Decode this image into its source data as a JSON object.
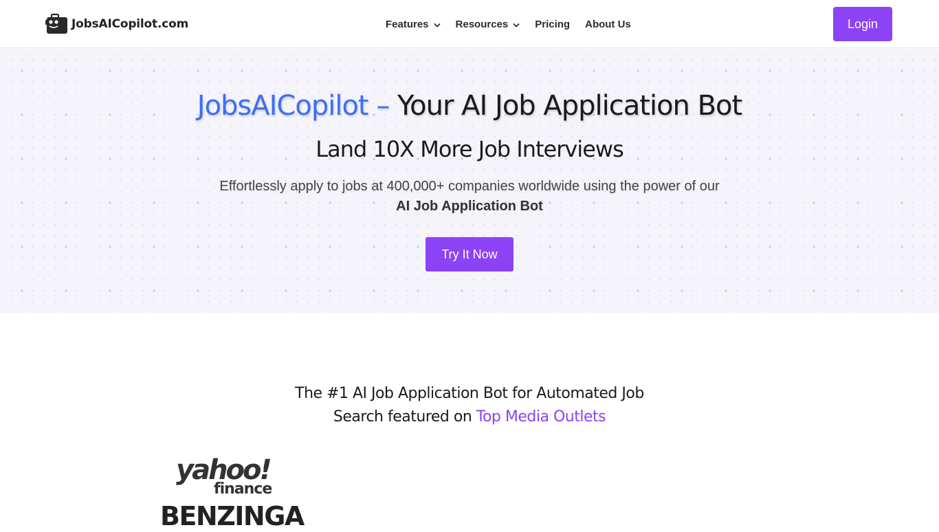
{
  "header": {
    "logo_text": "JobsAICopilot.com",
    "nav": [
      {
        "label": "Features",
        "has_dropdown": true
      },
      {
        "label": "Resources",
        "has_dropdown": true
      },
      {
        "label": "Pricing",
        "has_dropdown": false
      },
      {
        "label": "About Us",
        "has_dropdown": false
      }
    ],
    "login_label": "Login"
  },
  "hero": {
    "title_brand": "JobsAICopilot –",
    "title_rest": " Your AI Job Application Bot",
    "subtitle": "Land 10X More Job Interviews",
    "description": "Effortlessly apply to jobs at 400,000+ companies worldwide using the power of our",
    "description_bold": "AI Job Application Bot",
    "cta_label": "Try It Now"
  },
  "featured": {
    "heading_line1": "The #1 AI Job Application Bot for Automated Job",
    "heading_line2_prefix": "Search featured on ",
    "heading_accent": "Top Media Outlets",
    "logos": {
      "yahoo_main": "yahoo!",
      "yahoo_sub": "finance",
      "benzinga": "BENZINGA"
    }
  },
  "colors": {
    "accent_purple": "#8c42f5",
    "brand_blue": "#3d6ff2",
    "hero_bg": "#f5f4fa"
  },
  "icons": {
    "logo": "briefcase-robot-icon",
    "dropdown": "chevron-down-icon"
  }
}
